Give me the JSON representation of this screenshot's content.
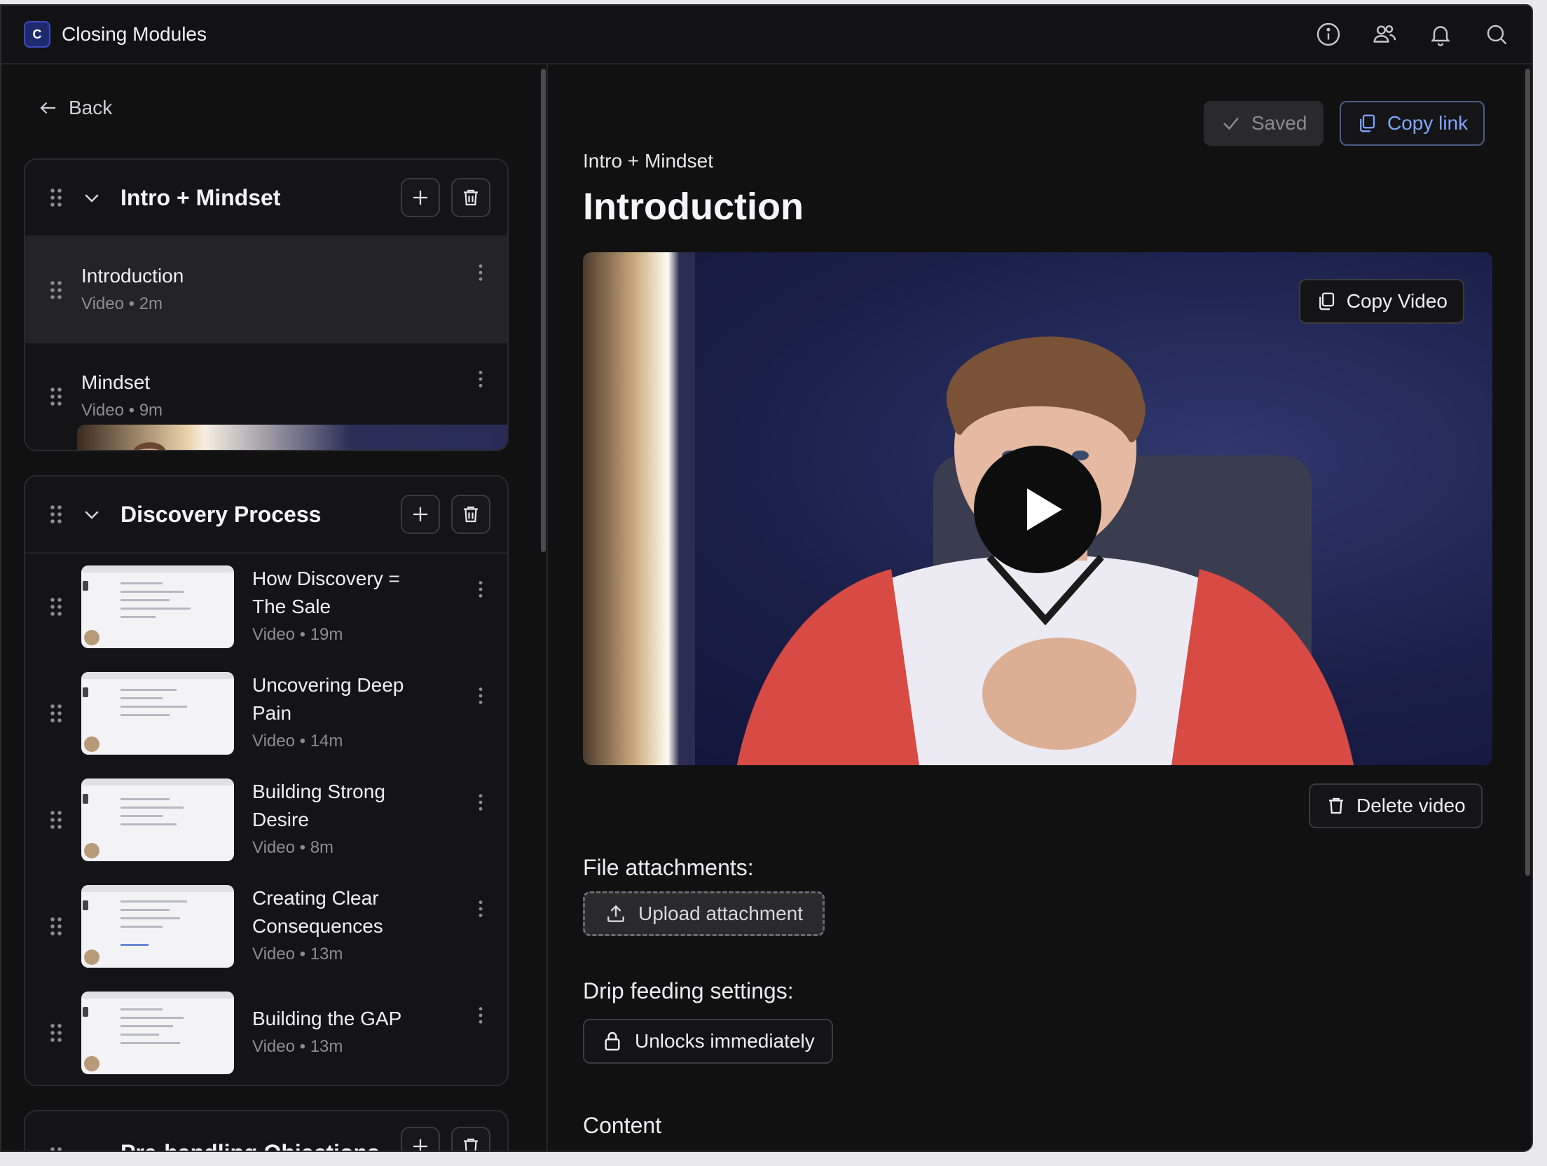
{
  "app": {
    "title": "Closing Modules",
    "logo_text": "C"
  },
  "topbar": {
    "icons": [
      "info-icon",
      "users-icon",
      "bell-icon",
      "search-icon"
    ]
  },
  "sidebar": {
    "back_label": "Back",
    "modules": [
      {
        "title": "Intro + Mindset",
        "lessons": [
          {
            "title": "Introduction",
            "meta": "Video • 2m",
            "thumb": "video",
            "active": true
          },
          {
            "title": "Mindset",
            "meta": "Video • 9m",
            "thumb": "video",
            "active": false
          }
        ]
      },
      {
        "title": "Discovery Process",
        "lessons": [
          {
            "title": "How Discovery = The Sale",
            "meta": "Video • 19m",
            "thumb": "doc"
          },
          {
            "title": "Uncovering Deep Pain",
            "meta": "Video • 14m",
            "thumb": "doc"
          },
          {
            "title": "Building Strong Desire",
            "meta": "Video • 8m",
            "thumb": "doc"
          },
          {
            "title": "Creating Clear Consequences",
            "meta": "Video • 13m",
            "thumb": "doc"
          },
          {
            "title": "Building the GAP",
            "meta": "Video • 13m",
            "thumb": "doc"
          }
        ]
      },
      {
        "title": "Pre-handling Objections",
        "lessons": []
      }
    ]
  },
  "main": {
    "saved_label": "Saved",
    "copy_link_label": "Copy link",
    "breadcrumb": "Intro + Mindset",
    "title": "Introduction",
    "copy_video_label": "Copy Video",
    "delete_video_label": "Delete video",
    "attachments_label": "File attachments:",
    "upload_label": "Upload attachment",
    "drip_label": "Drip feeding settings:",
    "unlock_label": "Unlocks immediately",
    "content_label": "Content"
  },
  "colors": {
    "background": "#111112",
    "accent_link": "#7fa6ff",
    "panel_border": "#2a2a2e"
  }
}
